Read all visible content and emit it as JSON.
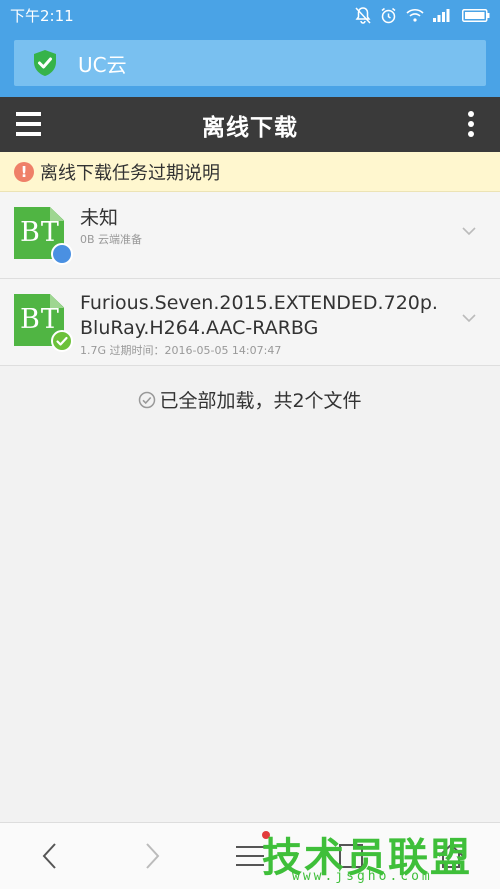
{
  "status_bar": {
    "time": "下午2:11"
  },
  "address_bar": {
    "text": "UC云"
  },
  "header": {
    "title": "离线下载"
  },
  "notice": {
    "text": "离线下载任务过期说明"
  },
  "files": [
    {
      "icon_label": "BT",
      "name": "未知",
      "meta": "0B  云端准备",
      "status": "pending"
    },
    {
      "icon_label": "BT",
      "name": "Furious.Seven.2015.EXTENDED.720p.BluRay.H264.AAC-RARBG",
      "meta": "1.7G  过期时间：2016-05-05 14:07:47",
      "status": "done"
    }
  ],
  "footer_status": {
    "text": "已全部加载，共2个文件"
  },
  "watermark": {
    "main": "技术员联盟",
    "sub": "www.jsgho.com"
  },
  "colors": {
    "status_bar": "#4aa3e6",
    "title_bar": "#3a3a3a",
    "notice_bg": "#fff7cf",
    "bt_green": "#50b543"
  }
}
